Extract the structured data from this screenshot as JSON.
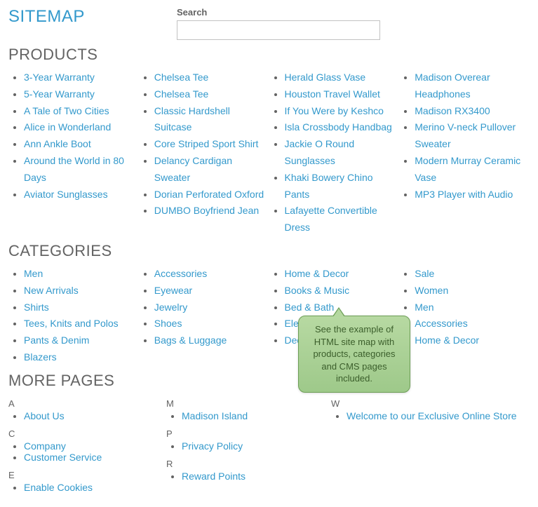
{
  "header": {
    "title": "SITEMAP",
    "search_label": "Search",
    "search_value": "",
    "search_placeholder": ""
  },
  "products": {
    "heading": "PRODUCTS",
    "cols": [
      [
        "3-Year Warranty",
        "5-Year Warranty",
        "A Tale of Two Cities",
        "Alice in Wonderland",
        "Ann Ankle Boot",
        "Around the World in 80 Days",
        "Aviator Sunglasses"
      ],
      [
        "Chelsea Tee",
        "Chelsea Tee",
        "Classic Hardshell Suitcase",
        "Core Striped Sport Shirt",
        "Delancy Cardigan Sweater",
        "Dorian Perforated Oxford",
        "DUMBO Boyfriend Jean"
      ],
      [
        "Herald Glass Vase",
        "Houston Travel Wallet",
        "If You Were by Keshco",
        "Isla Crossbody Handbag",
        "Jackie O Round Sunglasses",
        "Khaki Bowery Chino Pants",
        "Lafayette Convertible Dress"
      ],
      [
        "Madison Overear Headphones",
        "Madison RX3400",
        "Merino V-neck Pullover Sweater",
        "Modern Murray Ceramic Vase",
        "MP3 Player with Audio"
      ]
    ]
  },
  "categories": {
    "heading": "CATEGORIES",
    "cols": [
      [
        "Men",
        "New Arrivals",
        "Shirts",
        "Tees, Knits and Polos",
        "Pants & Denim",
        "Blazers"
      ],
      [
        "Accessories",
        "Eyewear",
        "Jewelry",
        "Shoes",
        "Bags & Luggage"
      ],
      [
        "Home & Decor",
        "Books & Music",
        "Bed & Bath",
        "Electronics",
        "Decorative Accents"
      ],
      [
        "Sale",
        "Women",
        "Men",
        "Accessories",
        "Home & Decor"
      ]
    ]
  },
  "more": {
    "heading": "MORE PAGES",
    "cols": [
      [
        {
          "letter": "A",
          "items": [
            "About Us"
          ]
        },
        {
          "letter": "C",
          "items": [
            "Company",
            "Customer Service"
          ]
        },
        {
          "letter": "E",
          "items": [
            "Enable Cookies"
          ]
        }
      ],
      [
        {
          "letter": "M",
          "items": [
            "Madison Island"
          ]
        },
        {
          "letter": "P",
          "items": [
            "Privacy Policy"
          ]
        },
        {
          "letter": "R",
          "items": [
            "Reward Points"
          ]
        }
      ],
      [
        {
          "letter": "W",
          "items": [
            "Welcome to our Exclusive Online Store"
          ]
        }
      ]
    ]
  },
  "callout": {
    "text": "See the example of HTML site map with products, categories and CMS pages included."
  }
}
